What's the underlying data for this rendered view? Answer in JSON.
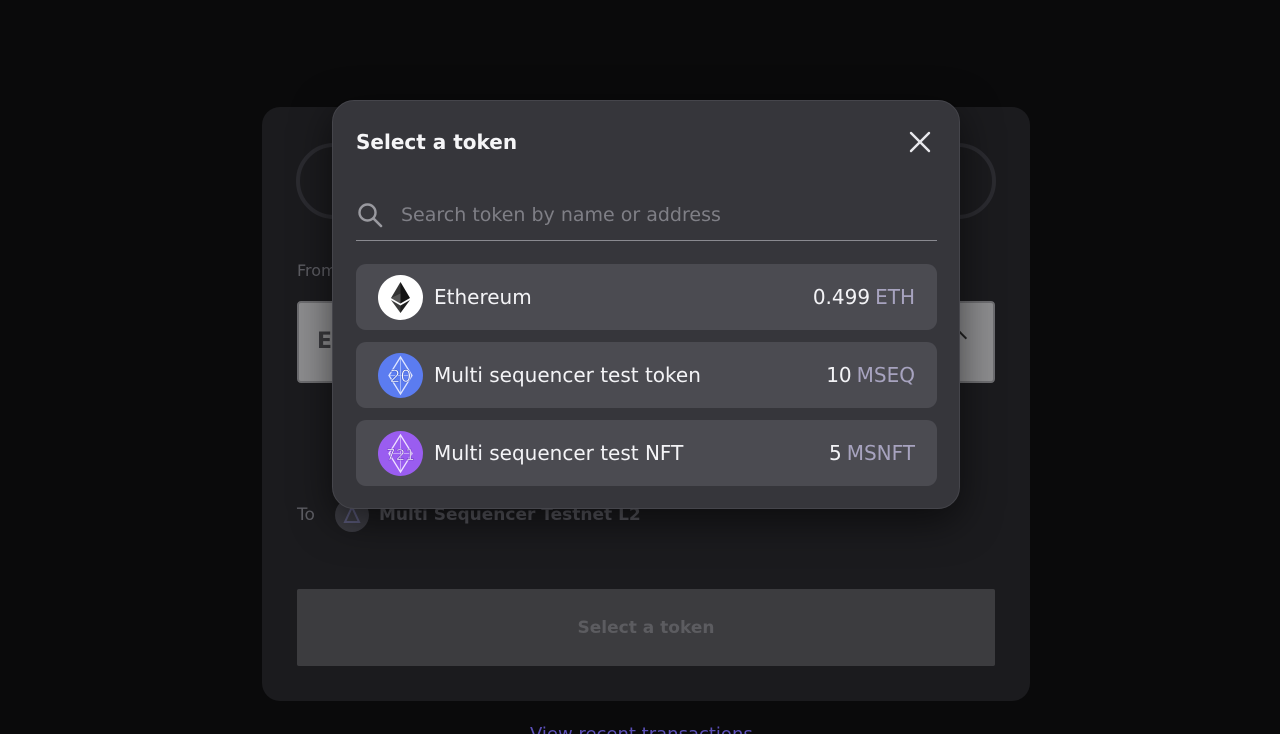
{
  "background": {
    "from_label": "From",
    "amount_prefix": "E",
    "to_label": "To",
    "to_network": "Multi Sequencer Testnet L2",
    "submit_label": "Select a token",
    "bottom_link": "View recent transactions"
  },
  "modal": {
    "title": "Select a token",
    "search_placeholder": "Search token by name or address",
    "search_value": ""
  },
  "tokens": [
    {
      "name": "Ethereum",
      "balance": "0.499",
      "symbol": "ETH",
      "icon": "ethereum-icon",
      "icon_color": "#ffffff"
    },
    {
      "name": "Multi sequencer test token",
      "balance": "10",
      "symbol": "MSEQ",
      "icon": "erc20-icon",
      "icon_label": "20",
      "icon_color": "#5b7cf0"
    },
    {
      "name": "Multi sequencer test NFT",
      "balance": "5",
      "symbol": "MSNFT",
      "icon": "erc721-icon",
      "icon_label": "721",
      "icon_color": "#9a5df0"
    }
  ],
  "colors": {
    "modal_bg": "#36363b",
    "row_bg": "#4b4b51",
    "symbol": "#a7a3bf",
    "page_bg": "#0a0a0b"
  }
}
